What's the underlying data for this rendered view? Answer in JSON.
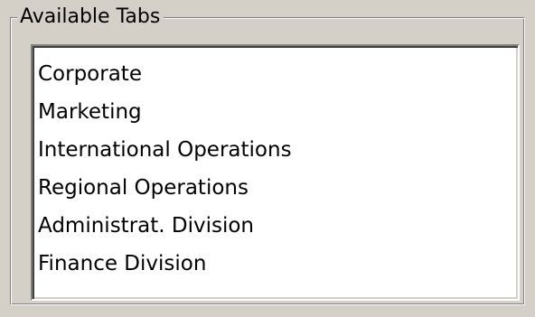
{
  "group": {
    "title": "Available Tabs"
  },
  "list": {
    "items": [
      "Corporate",
      "Marketing",
      "International Operations",
      "Regional Operations",
      "Administrat. Division",
      "Finance Division"
    ]
  }
}
